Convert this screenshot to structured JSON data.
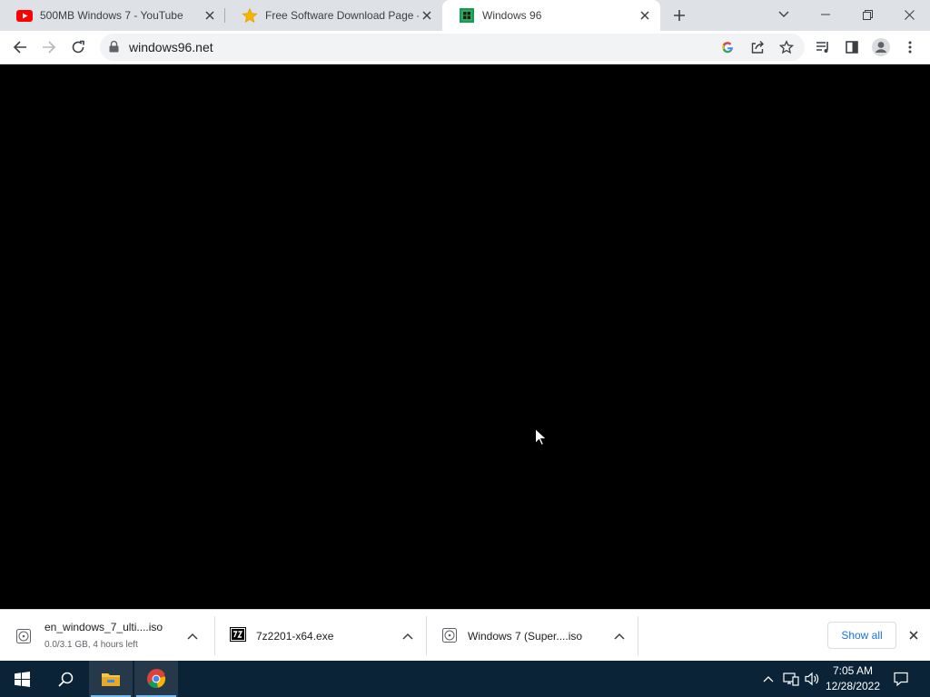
{
  "tabs": [
    {
      "title": "500MB Windows 7 - YouTube",
      "favicon": "youtube-icon",
      "active": false
    },
    {
      "title": "Free Software Download Page - S",
      "favicon": "star-icon",
      "active": false
    },
    {
      "title": "Windows 96",
      "favicon": "windows96-icon",
      "active": true
    }
  ],
  "address_bar": {
    "url": "windows96.net"
  },
  "downloads": [
    {
      "name": "en_windows_7_ulti....iso",
      "status": "0.0/3.1 GB, 4 hours left",
      "icon": "iso-file-icon"
    },
    {
      "name": "7z2201-x64.exe",
      "status": "",
      "icon": "7z-file-icon"
    },
    {
      "name": "Windows 7 (Super....iso",
      "status": "",
      "icon": "iso-file-icon"
    }
  ],
  "shelf": {
    "show_all_label": "Show all"
  },
  "taskbar": {
    "time": "7:05 AM",
    "date": "12/28/2022"
  },
  "colors": {
    "tab_strip": "#dee1e6",
    "page_background": "#000000",
    "taskbar": "#0a2336",
    "link_blue": "#1a73e8",
    "youtube_red": "#ff0000",
    "chrome_green": "#0f9d58"
  }
}
